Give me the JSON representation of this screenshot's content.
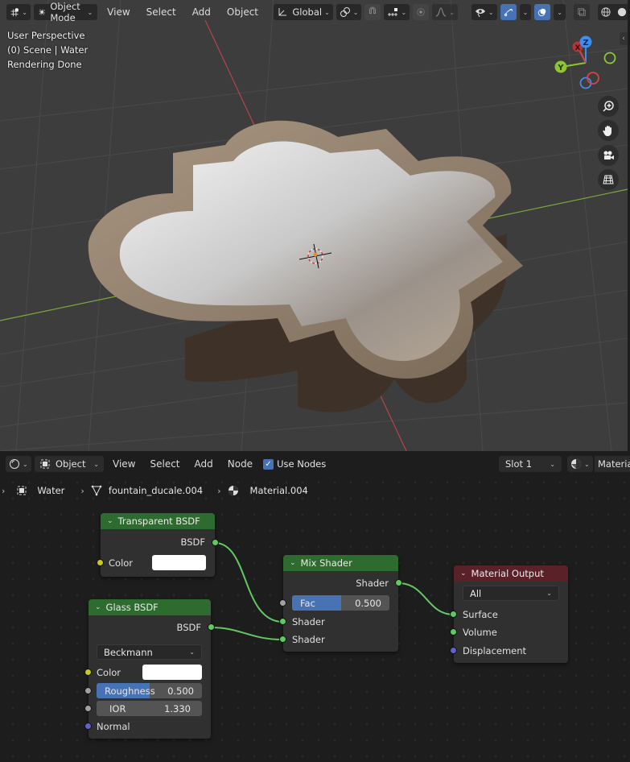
{
  "viewport": {
    "header": {
      "mode_label": "Object Mode",
      "menus": [
        "View",
        "Select",
        "Add",
        "Object"
      ],
      "transform_orientation": "Global"
    },
    "overlay": {
      "line1": "User Perspective",
      "line2": "(0) Scene | Water",
      "line3": "Rendering Done"
    },
    "gizmo": {
      "x": "X",
      "y": "Y",
      "z": "Z"
    },
    "colors": {
      "x_axis": "#d8434c",
      "y_axis": "#8ec62f",
      "z_axis": "#3f8ded",
      "active": "#4772b3"
    }
  },
  "node_editor": {
    "header": {
      "object_label": "Object",
      "menus": [
        "View",
        "Select",
        "Add",
        "Node"
      ],
      "use_nodes_label": "Use Nodes",
      "use_nodes_checked": true,
      "slot_label": "Slot 1",
      "material_label": "Materia"
    },
    "breadcrumb": {
      "object": "Water",
      "mesh": "fountain_ducale.004",
      "material": "Material.004"
    },
    "nodes": {
      "transparent": {
        "title": "Transparent BSDF",
        "output": "BSDF",
        "color_label": "Color",
        "color_value": "#ffffff"
      },
      "glass": {
        "title": "Glass BSDF",
        "output": "BSDF",
        "distribution": "Beckmann",
        "color_label": "Color",
        "color_value": "#ffffff",
        "roughness_label": "Roughness",
        "roughness_value": "0.500",
        "roughness_fraction": 0.5,
        "ior_label": "IOR",
        "ior_value": "1.330",
        "normal_label": "Normal"
      },
      "mix": {
        "title": "Mix Shader",
        "output": "Shader",
        "fac_label": "Fac",
        "fac_value": "0.500",
        "fac_fraction": 0.5,
        "input1": "Shader",
        "input2": "Shader"
      },
      "output": {
        "title": "Material Output",
        "target": "All",
        "surface": "Surface",
        "volume": "Volume",
        "displacement": "Displacement"
      }
    },
    "colors": {
      "node_header_shader": "#2d6b2e",
      "node_header_output": "#5a2128",
      "link": "#63c763"
    }
  }
}
